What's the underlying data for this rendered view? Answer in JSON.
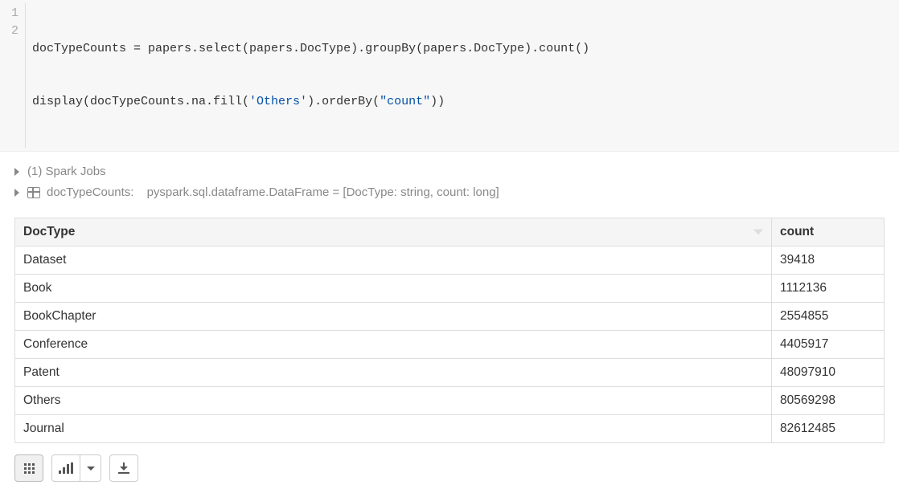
{
  "code": {
    "gutter": [
      "1",
      "2"
    ],
    "line1": {
      "a": "docTypeCounts = papers.select(papers.DocType).groupBy(papers.DocType).count()"
    },
    "line2": {
      "p1": "display(docTypeCounts.na.fill(",
      "s1": "'Others'",
      "p2": ").orderBy(",
      "s2": "\"count\"",
      "p3": "))"
    }
  },
  "meta": {
    "sparkJobs": "(1) Spark Jobs",
    "dfName": "docTypeCounts:",
    "dfType": "pyspark.sql.dataframe.DataFrame = [DocType: string, count: long]"
  },
  "table": {
    "headers": [
      "DocType",
      "count"
    ],
    "rows": [
      {
        "doctype": "Dataset",
        "count": "39418"
      },
      {
        "doctype": "Book",
        "count": "1112136"
      },
      {
        "doctype": "BookChapter",
        "count": "2554855"
      },
      {
        "doctype": "Conference",
        "count": "4405917"
      },
      {
        "doctype": "Patent",
        "count": "48097910"
      },
      {
        "doctype": "Others",
        "count": "80569298"
      },
      {
        "doctype": "Journal",
        "count": "82612485"
      }
    ]
  }
}
